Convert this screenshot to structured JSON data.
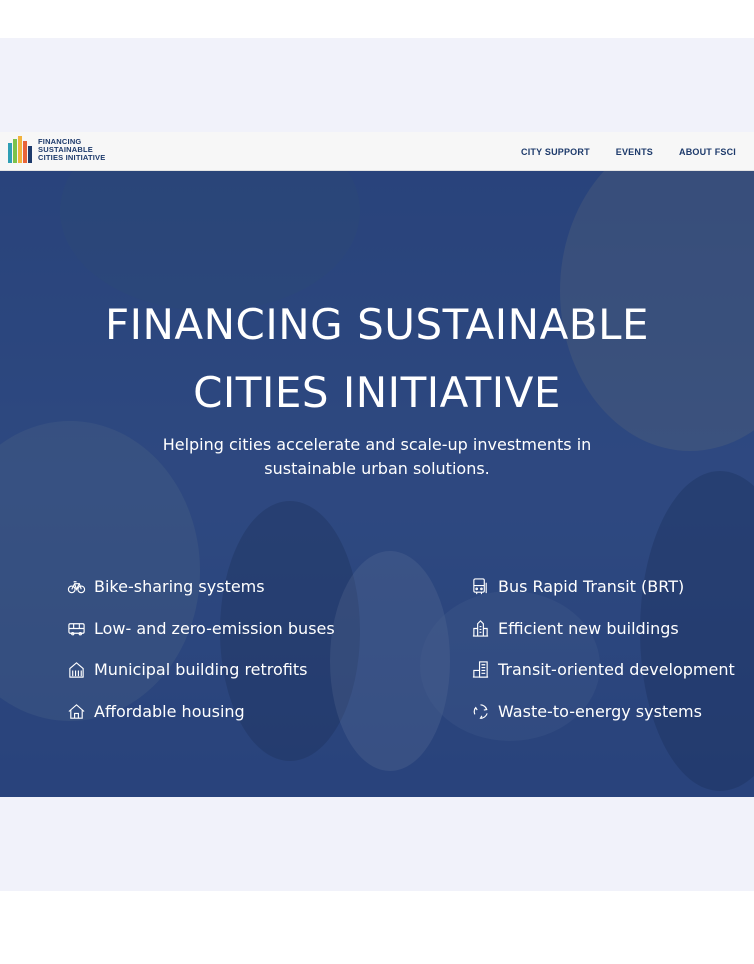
{
  "logo": {
    "lines": [
      "FINANCING",
      "SUSTAINABLE",
      "CITIES INITIATIVE"
    ],
    "colors": [
      "#2f9fb5",
      "#7cc24b",
      "#f2b33d",
      "#e8643a",
      "#1d3a6b"
    ]
  },
  "nav": {
    "items": [
      "CITY SUPPORT",
      "EVENTS",
      "ABOUT FSCI"
    ]
  },
  "hero": {
    "title_lines": [
      "FINANCING SUSTAINABLE",
      "CITIES INITIATIVE"
    ],
    "subtitle_lines": [
      "Helping cities accelerate and scale-up investments in",
      "sustainable urban solutions."
    ]
  },
  "solutions": {
    "left": [
      {
        "label": "Bike-sharing systems",
        "icon": "bicycle-icon"
      },
      {
        "label": "Low- and zero-emission buses",
        "icon": "bus-icon"
      },
      {
        "label": "Municipal building retrofits",
        "icon": "building-retrofit-icon"
      },
      {
        "label": "Affordable housing",
        "icon": "house-icon"
      }
    ],
    "right": [
      {
        "label": "Bus Rapid Transit (BRT)",
        "icon": "brt-icon"
      },
      {
        "label": "Efficient new buildings",
        "icon": "skyscraper-icon"
      },
      {
        "label": "Transit-oriented development",
        "icon": "transit-building-icon"
      },
      {
        "label": "Waste-to-energy systems",
        "icon": "recycle-icon"
      }
    ]
  },
  "colors": {
    "navy": "#1d3a6b",
    "hero_blue": "#223e78",
    "band": "#f1f2fa"
  }
}
